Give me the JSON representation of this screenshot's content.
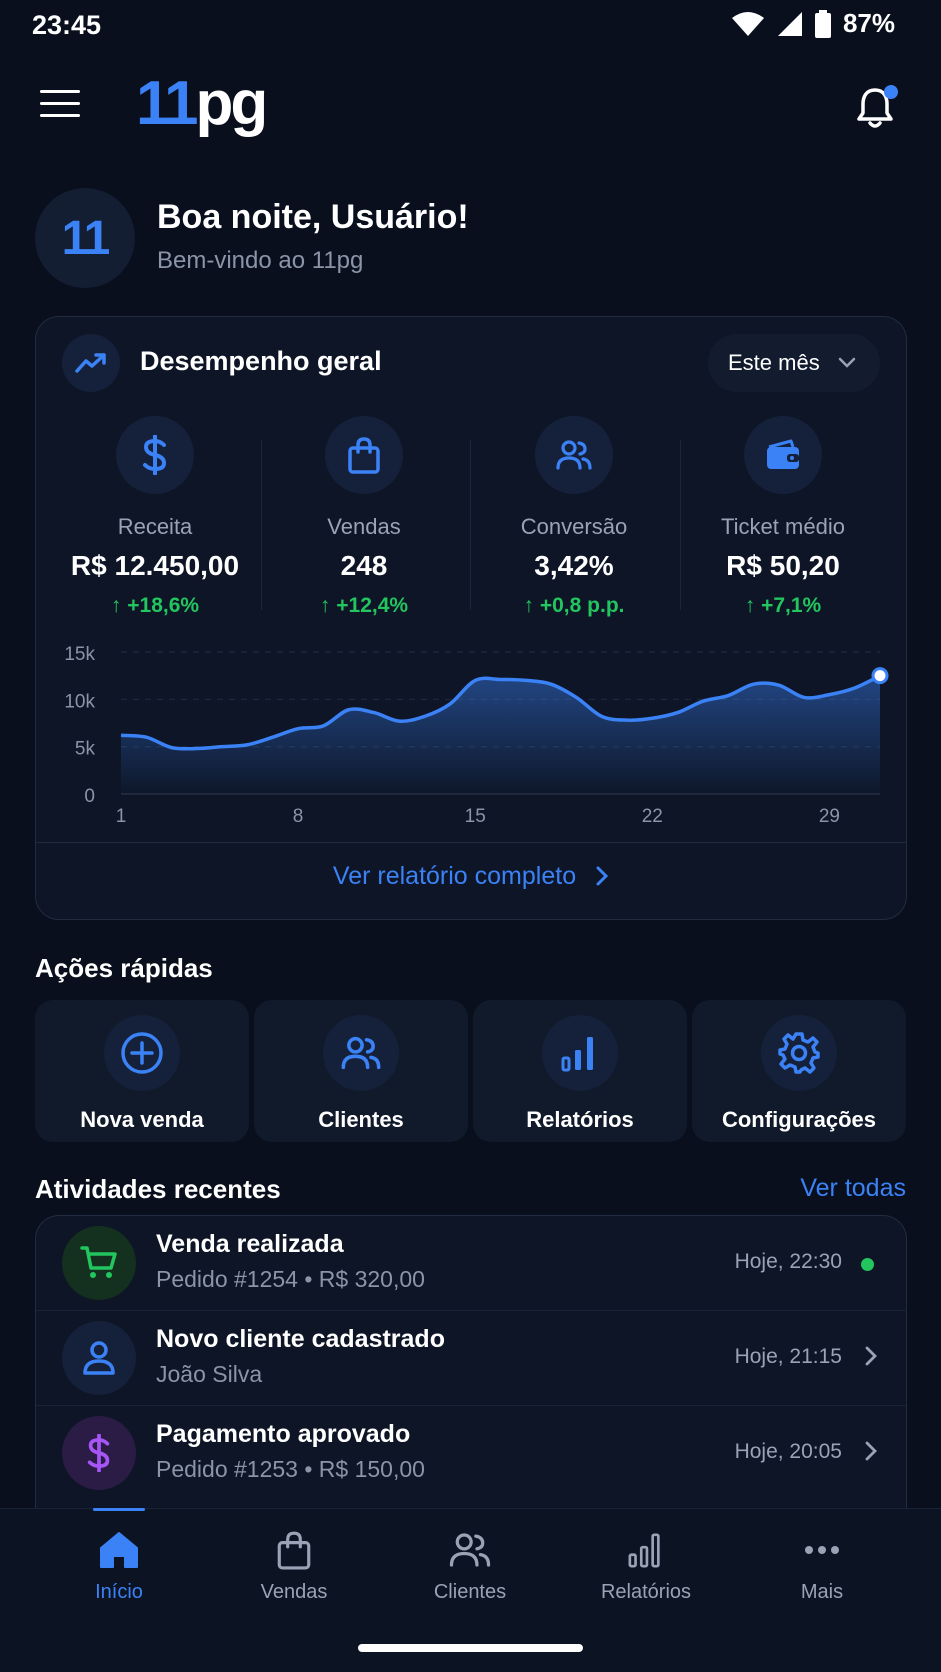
{
  "status_bar": {
    "time": "23:45",
    "battery": "87%"
  },
  "header": {
    "logo_accent": "11",
    "logo_rest": "pg"
  },
  "greeting": {
    "avatar_text": "11",
    "title": "Boa noite, Usuário!",
    "subtitle": "Bem-vindo ao 11pg"
  },
  "performance": {
    "title": "Desempenho geral",
    "period": "Este mês",
    "metrics": [
      {
        "icon": "dollar-icon",
        "label": "Receita",
        "value": "R$ 12.450,00",
        "delta": "+18,6%"
      },
      {
        "icon": "bag-icon",
        "label": "Vendas",
        "value": "248",
        "delta": "+12,4%"
      },
      {
        "icon": "users-icon",
        "label": "Conversão",
        "value": "3,42%",
        "delta": "+0,8 p.p."
      },
      {
        "icon": "wallet-icon",
        "label": "Ticket médio",
        "value": "R$ 50,20",
        "delta": "+7,1%"
      }
    ],
    "report_link": "Ver relatório completo"
  },
  "chart_data": {
    "type": "area",
    "x": [
      1,
      2,
      3,
      4,
      5,
      6,
      7,
      8,
      9,
      10,
      11,
      12,
      13,
      14,
      15,
      16,
      17,
      18,
      19,
      20,
      21,
      22,
      23,
      24,
      25,
      26,
      27,
      28,
      29,
      30,
      31
    ],
    "values": [
      6200,
      6000,
      4900,
      4800,
      5000,
      5200,
      6000,
      6900,
      7200,
      8900,
      8600,
      7700,
      8200,
      9500,
      12000,
      12100,
      12000,
      11600,
      10200,
      8200,
      7800,
      8000,
      8600,
      9800,
      10400,
      11600,
      11500,
      10200,
      10500,
      11200,
      12500
    ],
    "yticks": [
      "15k",
      "10k",
      "5k",
      "0"
    ],
    "xticks": [
      "1",
      "8",
      "15",
      "22",
      "29"
    ],
    "ylim": [
      0,
      15000
    ],
    "grid": true,
    "color": "#3b82f6"
  },
  "quick_actions": {
    "title": "Ações rápidas",
    "items": [
      {
        "icon": "plus-circle-icon",
        "label": "Nova venda"
      },
      {
        "icon": "users-icon",
        "label": "Clientes"
      },
      {
        "icon": "bar-chart-icon",
        "label": "Relatórios"
      },
      {
        "icon": "gear-icon",
        "label": "Configurações"
      }
    ]
  },
  "recent": {
    "title": "Atividades recentes",
    "see_all": "Ver todas",
    "items": [
      {
        "icon": "cart-icon",
        "title": "Venda realizada",
        "subtitle": "Pedido #1254 • R$ 320,00",
        "time": "Hoje, 22:30",
        "color": "#22c55e"
      },
      {
        "icon": "user-icon",
        "title": "Novo cliente cadastrado",
        "subtitle": "João Silva",
        "time": "Hoje, 21:15",
        "color": "#3b82f6"
      },
      {
        "icon": "dollar-icon",
        "title": "Pagamento aprovado",
        "subtitle": "Pedido #1253 • R$ 150,00",
        "time": "Hoje, 20:05",
        "color": "#a855f7"
      }
    ]
  },
  "bottom_nav": [
    {
      "icon": "home-icon",
      "label": "Início",
      "active": true
    },
    {
      "icon": "bag-icon",
      "label": "Vendas"
    },
    {
      "icon": "users-icon",
      "label": "Clientes"
    },
    {
      "icon": "bar-chart-icon",
      "label": "Relatórios"
    },
    {
      "icon": "more-icon",
      "label": "Mais"
    }
  ],
  "colors": {
    "accent": "#3b82f6",
    "positive": "#22c55e",
    "background": "#090f1d"
  }
}
